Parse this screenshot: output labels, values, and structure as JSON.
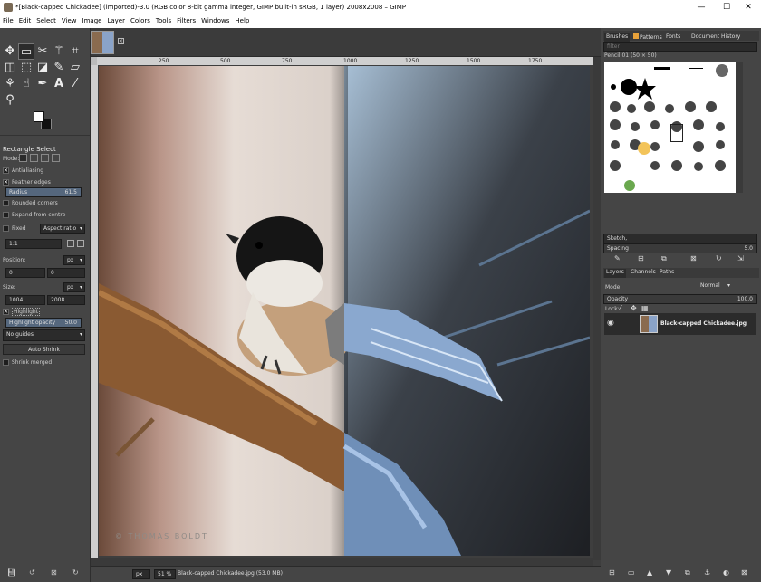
{
  "window": {
    "title": "*[Black-capped Chickadee] (imported)-3.0 (RGB color 8-bit gamma integer, GIMP built-in sRGB, 1 layer) 2008x2008 – GIMP",
    "minimize": "—",
    "maximize": "☐",
    "close": "✕"
  },
  "menu": [
    "File",
    "Edit",
    "Select",
    "View",
    "Image",
    "Layer",
    "Colors",
    "Tools",
    "Filters",
    "Windows",
    "Help"
  ],
  "tool_options": {
    "title": "Rectangle Select",
    "mode_label": "Mode:",
    "antialiasing": "Antialiasing",
    "feather_edges": "Feather edges",
    "radius_label": "Radius",
    "radius_value": "61.5",
    "rounded_corners": "Rounded corners",
    "expand_from_centre": "Expand from centre",
    "fixed_label": "Fixed",
    "fixed_value": "Aspect ratio",
    "ratio_value": "1:1",
    "position_label": "Position:",
    "position_unit": "px",
    "position_x": "0",
    "position_y": "0",
    "size_label": "Size:",
    "size_unit": "px",
    "size_w": "1004",
    "size_h": "2008",
    "highlight": "Highlight",
    "highlight_opacity_label": "Highlight opacity",
    "highlight_opacity_value": "50.0",
    "guides_value": "No guides",
    "auto_shrink": "Auto Shrink",
    "shrink_merged": "Shrink merged"
  },
  "ruler": {
    "marks": [
      "250",
      "500",
      "750",
      "1000",
      "1250",
      "1500",
      "1750"
    ]
  },
  "image": {
    "watermark": "© THOMAS BOLDT"
  },
  "statusbar": {
    "unit": "px",
    "zoom": "51 %",
    "text": "Black-capped Chickadee.jpg (53.0 MB)"
  },
  "brushes_dock": {
    "tabs": [
      "Brushes",
      "Patterns",
      "Fonts",
      "Document History"
    ],
    "filter_placeholder": "filter",
    "brush_name": "Pencil 01 (50 × 50)",
    "tag_value": "Sketch,",
    "spacing_label": "Spacing",
    "spacing_value": "5.0"
  },
  "layers_dock": {
    "tabs": [
      "Layers",
      "Channels",
      "Paths"
    ],
    "mode_label": "Mode",
    "mode_value": "Normal",
    "opacity_label": "Opacity",
    "opacity_value": "100.0",
    "lock_label": "Lock:",
    "layer_name": "Black-capped Chickadee.jpg"
  }
}
